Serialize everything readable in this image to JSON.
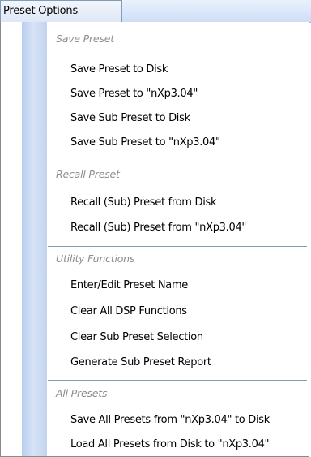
{
  "menubar": {
    "title": "Preset Options"
  },
  "groups": [
    {
      "header": "Save Preset",
      "items": [
        "Save Preset to Disk",
        "Save Preset to \"nXp3.04\"",
        "Save Sub Preset to Disk",
        "Save Sub Preset to \"nXp3.04\""
      ]
    },
    {
      "header": "Recall Preset",
      "items": [
        "Recall (Sub) Preset from Disk",
        "Recall (Sub) Preset from \"nXp3.04\""
      ]
    },
    {
      "header": "Utility Functions",
      "items": [
        "Enter/Edit Preset Name",
        "Clear All DSP Functions",
        "Clear Sub Preset Selection",
        "Generate Sub Preset Report"
      ]
    },
    {
      "header": "All Presets",
      "items": [
        "Save All Presets from \"nXp3.04\" to Disk",
        "Load All Presets from Disk to \"nXp3.04\""
      ]
    }
  ]
}
